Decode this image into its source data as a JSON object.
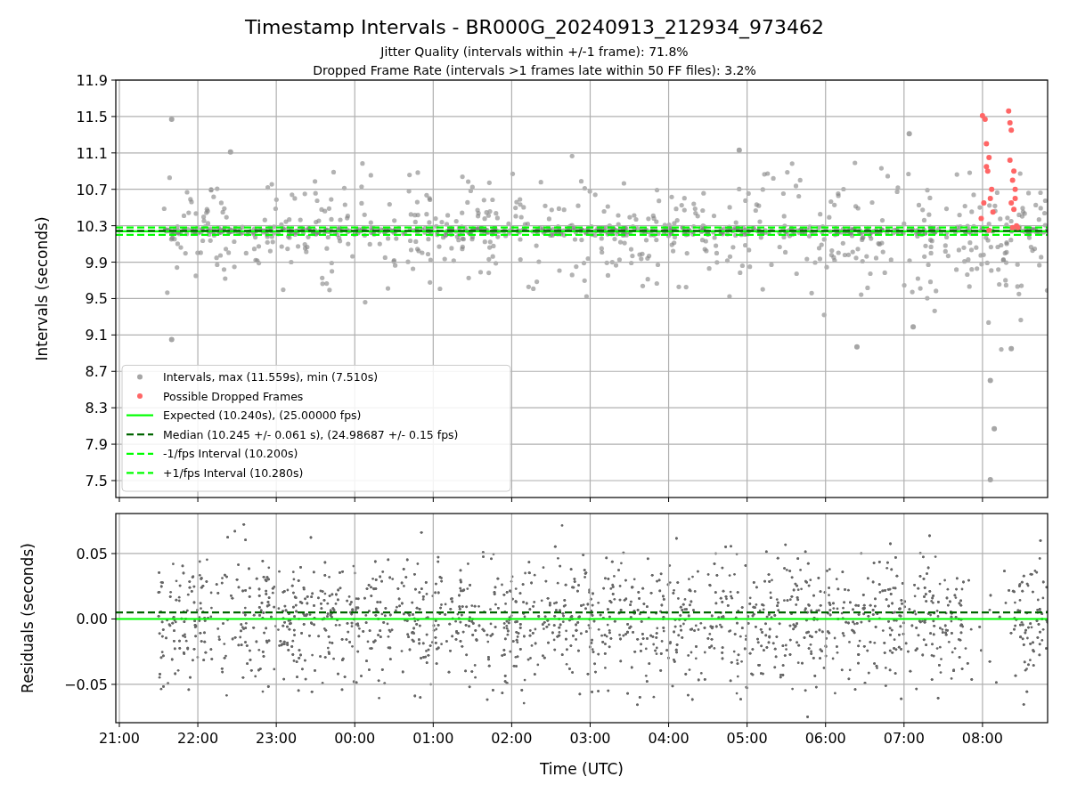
{
  "figure": {
    "title": "Timestamp Intervals - BR000G_20240913_212934_973462",
    "subtitles": [
      "Jitter Quality (intervals within +/-1 frame): 71.8%",
      "Dropped Frame Rate (intervals >1 frames late within 50 FF files): 3.2%"
    ]
  },
  "intervals_plot": {
    "chart_data": {
      "type": "scatter",
      "ylabel": "Intervals (seconds)",
      "grid": true,
      "legend": "lower left",
      "xlim": [
        "2024-09-13T20:57:17",
        "2024-09-14T08:49:48"
      ],
      "ylim": [
        7.314,
        11.9
      ],
      "yticks": [
        {
          "value": 7.5,
          "label": "7.5"
        },
        {
          "value": 7.9,
          "label": "7.9"
        },
        {
          "value": 8.3,
          "label": "8.3"
        },
        {
          "value": 8.7,
          "label": "8.7"
        },
        {
          "value": 9.1,
          "label": "9.1"
        },
        {
          "value": 9.5,
          "label": "9.5"
        },
        {
          "value": 9.9,
          "label": "9.9"
        },
        {
          "value": 10.3,
          "label": "10.3"
        },
        {
          "value": 10.7,
          "label": "10.7"
        },
        {
          "value": 11.1,
          "label": "11.1"
        },
        {
          "value": 11.5,
          "label": "11.5"
        },
        {
          "value": 11.9,
          "label": "11.9"
        }
      ],
      "series": [
        {
          "name": "Intervals, max (11.559s), min (7.510s)",
          "color": "#a6a6a6",
          "x": [
            "2024-09-13T21:40",
            "2024-09-13T21:40",
            "2024-09-14T06:24",
            "2024-09-14T08:06",
            "2024-09-14T08:09",
            "2024-09-14T08:06",
            "2024-09-14T08:22",
            "2024-09-13T22:25",
            "2024-09-14T04:54",
            "2024-09-14T07:04",
            "2024-09-14T07:07"
          ],
          "values": [
            11.47,
            9.05,
            8.97,
            7.51,
            8.07,
            8.6,
            8.95,
            11.11,
            11.13,
            11.31,
            9.19
          ]
        },
        {
          "name": "Possible Dropped Frames",
          "color": "#ff6666",
          "x": [
            "2024-09-14T07:59",
            "2024-09-14T08:00",
            "2024-09-14T08:01",
            "2024-09-14T08:02",
            "2024-09-14T08:03",
            "2024-09-14T08:04",
            "2024-09-14T08:05",
            "2024-09-14T08:06",
            "2024-09-14T08:07",
            "2024-09-14T08:08",
            "2024-09-14T08:20",
            "2024-09-14T08:21",
            "2024-09-14T08:22",
            "2024-09-14T08:23",
            "2024-09-14T08:24",
            "2024-09-14T08:25",
            "2024-09-14T08:26",
            "2024-09-14T08:22",
            "2024-09-14T08:24",
            "2024-09-14T08:27",
            "2024-09-14T08:23",
            "2024-09-14T08:25",
            "2024-09-14T08:03",
            "2024-09-14T08:05",
            "2024-09-14T08:21"
          ],
          "values": [
            10.38,
            11.51,
            10.55,
            11.47,
            11.2,
            10.9,
            11.05,
            10.6,
            10.7,
            10.45,
            11.56,
            11.43,
            11.35,
            10.28,
            10.9,
            10.7,
            10.3,
            10.55,
            10.48,
            10.28,
            10.8,
            10.6,
            10.95,
            10.25,
            11.02
          ]
        },
        {
          "name": "Expected (10.240s), (25.00000 fps)",
          "type": "line",
          "line_style": "solid",
          "color": "#00ff00",
          "x": [
            "2024-09-13T20:57:17",
            "2024-09-14T08:49:48"
          ],
          "values": [
            10.24,
            10.24
          ]
        },
        {
          "name": "Median (10.245 +/- 0.061 s), (24.98687 +/- 0.15 fps)",
          "type": "line",
          "line_style": "dashed",
          "color": "#006400",
          "x": [
            "2024-09-13T20:57:17",
            "2024-09-14T08:49:48"
          ],
          "values": [
            10.245,
            10.245
          ]
        },
        {
          "name": "-1/fps Interval (10.200s)",
          "type": "line",
          "line_style": "dashed",
          "color": "#00ff00",
          "x": [
            "2024-09-13T20:57:17",
            "2024-09-14T08:49:48"
          ],
          "values": [
            10.2,
            10.2
          ]
        },
        {
          "name": "+1/fps Interval (10.280s)",
          "type": "line",
          "line_style": "dashed",
          "color": "#00ff00",
          "x": [
            "2024-09-13T20:57:17",
            "2024-09-14T08:49:48"
          ],
          "values": [
            10.28,
            10.28
          ]
        }
      ]
    }
  },
  "residuals_plot": {
    "chart_data": {
      "type": "scatter",
      "xlabel": "Time (UTC)",
      "ylabel": "Residuals (seconds)",
      "grid": true,
      "xlim": [
        "2024-09-13T20:57:17",
        "2024-09-14T08:49:48"
      ],
      "ylim": [
        -0.0793,
        0.0806
      ],
      "xticks": [
        {
          "value": "2024-09-13T21:00",
          "label": "21:00"
        },
        {
          "value": "2024-09-13T22:00",
          "label": "22:00"
        },
        {
          "value": "2024-09-13T23:00",
          "label": "23:00"
        },
        {
          "value": "2024-09-14T00:00",
          "label": "00:00"
        },
        {
          "value": "2024-09-14T01:00",
          "label": "01:00"
        },
        {
          "value": "2024-09-14T02:00",
          "label": "02:00"
        },
        {
          "value": "2024-09-14T03:00",
          "label": "03:00"
        },
        {
          "value": "2024-09-14T04:00",
          "label": "04:00"
        },
        {
          "value": "2024-09-14T05:00",
          "label": "05:00"
        },
        {
          "value": "2024-09-14T06:00",
          "label": "06:00"
        },
        {
          "value": "2024-09-14T07:00",
          "label": "07:00"
        },
        {
          "value": "2024-09-14T08:00",
          "label": "08:00"
        }
      ],
      "yticks": [
        {
          "value": -0.05,
          "label": "−0.05"
        },
        {
          "value": 0,
          "label": "0.00"
        },
        {
          "value": 0.05,
          "label": "0.05"
        }
      ],
      "series": [
        {
          "type": "line",
          "line_style": "solid",
          "color": "#00ff00",
          "x": [
            "2024-09-13T20:57:17",
            "2024-09-14T08:49:48"
          ],
          "values": [
            0,
            0
          ]
        },
        {
          "type": "line",
          "line_style": "dashed",
          "color": "#006400",
          "x": [
            "2024-09-13T20:57:17",
            "2024-09-14T08:49:48"
          ],
          "values": [
            0.005,
            0.005
          ]
        }
      ]
    }
  }
}
